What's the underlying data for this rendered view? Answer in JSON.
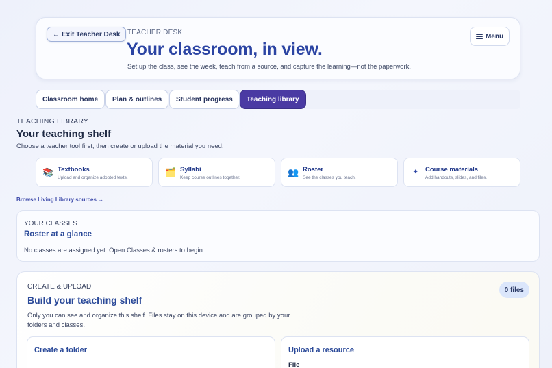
{
  "header": {
    "exit_label": "Exit Teacher Desk",
    "exit_arrow": "←",
    "eyebrow": "TEACHER DESK",
    "title": "Your classroom, in view.",
    "subtitle": "Set up the class, see the week, teach from a source, and capture the learning—not the paperwork.",
    "menu_label": "Menu",
    "menu_icon": "hamburger-icon"
  },
  "tabs": [
    {
      "label": "Classroom home",
      "active": false
    },
    {
      "label": "Plan & outlines",
      "active": false
    },
    {
      "label": "Student progress",
      "active": false
    },
    {
      "label": "Teaching library",
      "active": true
    }
  ],
  "library": {
    "eyebrow": "TEACHING LIBRARY",
    "title": "Your teaching shelf",
    "subtitle": "Choose a teacher tool first, then create or upload the material you need.",
    "tools": [
      {
        "icon": "books-icon",
        "glyph": "📚",
        "title": "Textbooks",
        "desc": "Upload and organize adopted texts."
      },
      {
        "icon": "folder-icon",
        "glyph": "🗂️",
        "title": "Syllabi",
        "desc": "Keep course outlines together."
      },
      {
        "icon": "people-icon",
        "glyph": "👥",
        "title": "Roster",
        "desc": "See the classes you teach."
      },
      {
        "icon": "sparkle-icon",
        "glyph": "✦",
        "title": "Course materials",
        "desc": "Add handouts, slides, and files."
      }
    ],
    "browse_link": "Browse Living Library sources →"
  },
  "classes": {
    "eyebrow": "YOUR CLASSES",
    "title": "Roster at a glance",
    "empty_text": "No classes are assigned yet. Open Classes & rosters to begin."
  },
  "create": {
    "eyebrow": "CREATE & UPLOAD",
    "title": "Build your teaching shelf",
    "subtitle": "Only you can see and organize this shelf. Files stay on this device and are grouped by your folders and classes.",
    "files_count": "0 files",
    "folder_card_title": "Create a folder",
    "upload_card_title": "Upload a resource",
    "upload_field_label": "File"
  },
  "colors": {
    "accent": "#2b44a3",
    "active_tab": "#4a3aa3",
    "background": "#eef1fb"
  }
}
